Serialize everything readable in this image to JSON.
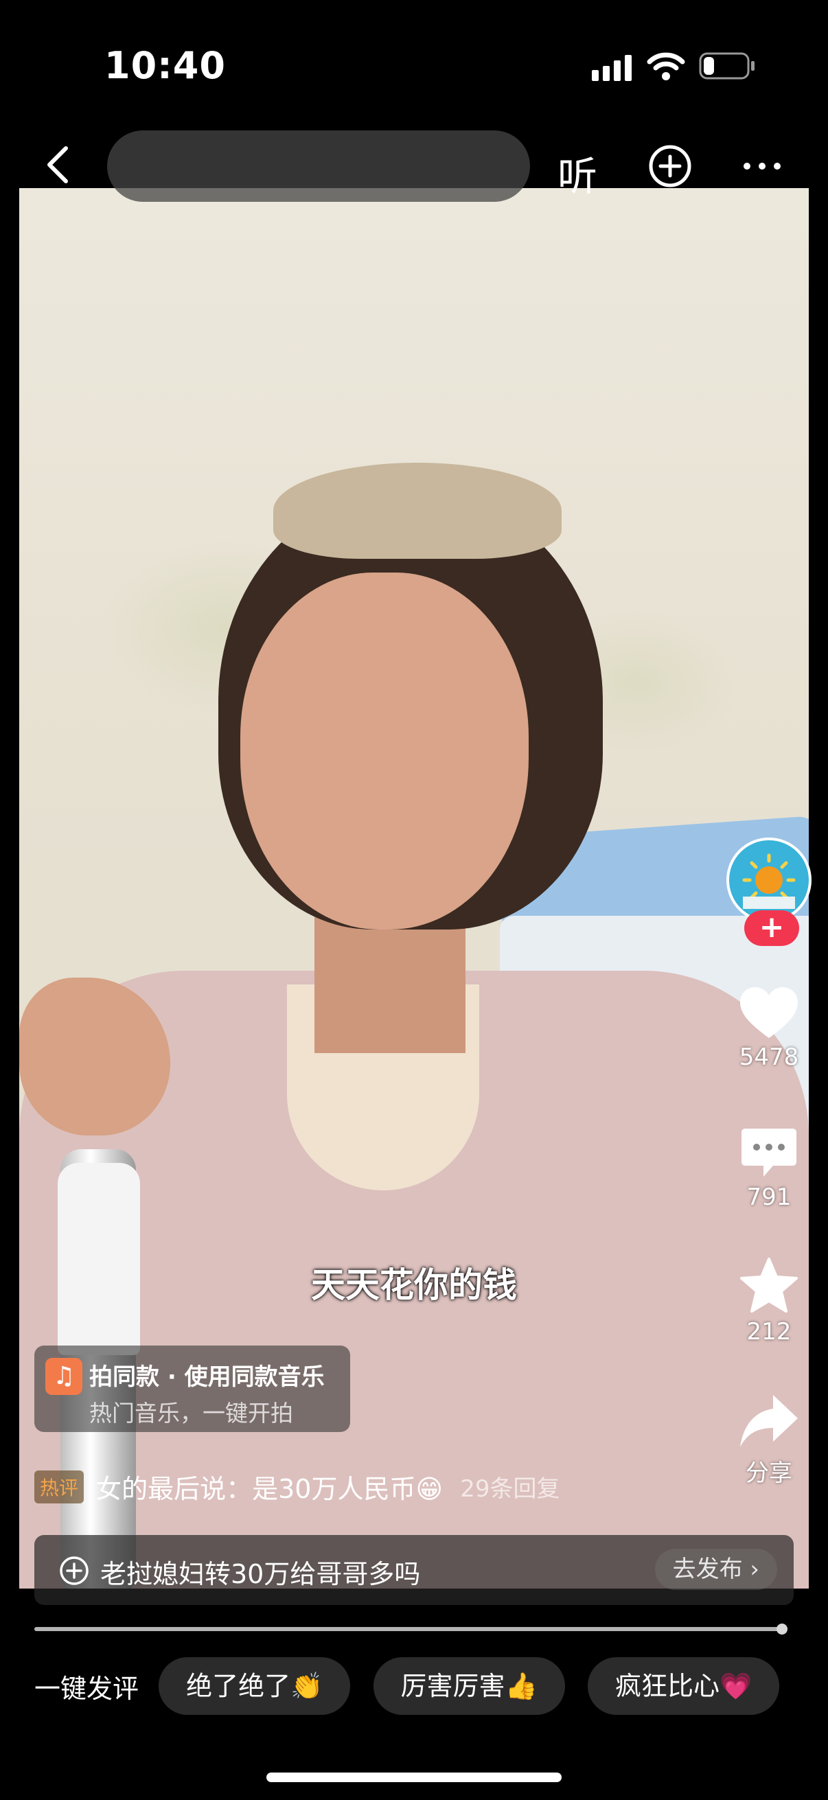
{
  "status": {
    "time": "10:40",
    "battery_level": 0.25
  },
  "header": {
    "search_placeholder": "",
    "listen_label": "听"
  },
  "video": {
    "subtitle": "天天花你的钱"
  },
  "music": {
    "title": "拍同款 · 使用同款音乐",
    "subtitle": "热门音乐，一键开拍"
  },
  "hot_comment": {
    "tag": "热评",
    "text": "女的最后说：是30万人民币😁",
    "replies": "29条回复"
  },
  "comment_bar": {
    "text": "老挝媳妇转30万给哥哥多吗",
    "publish_label": "去发布 ›"
  },
  "rail": {
    "likes": "5478",
    "comments": "791",
    "favorites": "212",
    "share_label": "分享",
    "follow_symbol": "+"
  },
  "progress": {
    "played_fraction": 0.995
  },
  "quick_comments": {
    "label": "一键发评",
    "chips": [
      "绝了绝了👏",
      "厉害厉害👍",
      "疯狂比心💗"
    ]
  },
  "colors": {
    "follow": "#f2364f",
    "hot_tag": "#f3a54a",
    "music_icon": "#f37b4a"
  }
}
